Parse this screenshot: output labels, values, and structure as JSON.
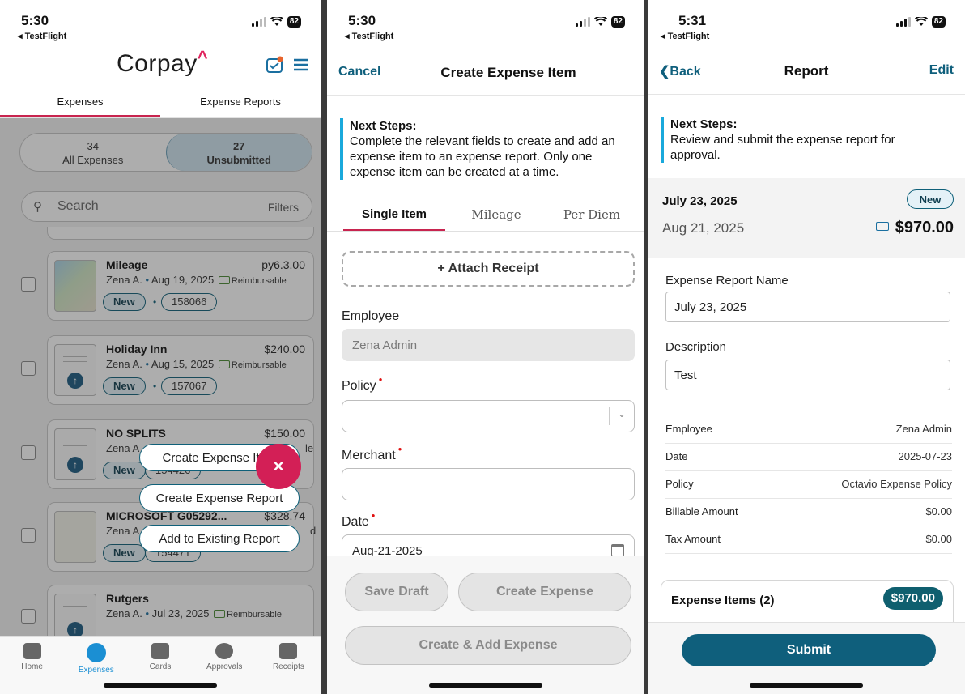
{
  "screen1": {
    "status": {
      "time": "5:30",
      "testflight": "◂ TestFlight",
      "battery": "82"
    },
    "logo": "Corpay",
    "tabs": [
      "Expenses",
      "Expense Reports"
    ],
    "segment": {
      "all_count": "34",
      "all_label": "All Expenses",
      "unsub_count": "27",
      "unsub_label": "Unsubmitted"
    },
    "search": {
      "placeholder": "Search",
      "filters": "Filters"
    },
    "cards": [
      {
        "name": "Mileage",
        "amount": "py6.3.00",
        "meta": "Zena A.",
        "date": "Aug 19, 2025",
        "reimb": "Reimbursable",
        "status": "New",
        "id": "158066"
      },
      {
        "name": "Holiday Inn",
        "amount": "$240.00",
        "meta": "Zena A.",
        "date": "Aug 15, 2025",
        "reimb": "Reimbursable",
        "status": "New",
        "id": "157067"
      },
      {
        "name": "NO SPLITS",
        "amount": "$150.00",
        "meta": "Zena A",
        "date": "",
        "reimb": "le",
        "status": "New",
        "id": "154426"
      },
      {
        "name": "MICROSOFT G05292...",
        "amount": "$328.74",
        "meta": "Zena A",
        "date": "",
        "reimb": "d",
        "status": "New",
        "id": "154471"
      },
      {
        "name": "Rutgers",
        "amount": "",
        "meta": "Zena A.",
        "date": "Jul 23, 2025",
        "reimb": "Reimbursable",
        "status": "",
        "id": ""
      }
    ],
    "menu": [
      "Create Expense Item",
      "Create Expense Report",
      "Add to Existing Report"
    ],
    "fab": "×",
    "tabbar": [
      "Home",
      "Expenses",
      "Cards",
      "Approvals",
      "Receipts"
    ]
  },
  "screen2": {
    "status": {
      "time": "5:30",
      "testflight": "◂ TestFlight",
      "battery": "82"
    },
    "nav": {
      "cancel": "Cancel",
      "title": "Create Expense Item"
    },
    "next_steps": {
      "title": "Next Steps:",
      "body": "Complete the relevant fields to create and add an expense item to an expense report. Only one expense item can be created at a time."
    },
    "tabs": [
      "Single Item",
      "Mileage",
      "Per Diem"
    ],
    "attach": "+ Attach Receipt",
    "fields": {
      "employee_label": "Employee",
      "employee_value": "Zena Admin",
      "policy_label": "Policy",
      "merchant_label": "Merchant",
      "date_label": "Date",
      "date_value": "Aug-21-2025"
    },
    "buttons": {
      "save_draft": "Save Draft",
      "create": "Create Expense",
      "create_add": "Create & Add Expense"
    }
  },
  "screen3": {
    "status": {
      "time": "5:31",
      "testflight": "◂ TestFlight",
      "battery": "82"
    },
    "nav": {
      "back": "Back",
      "title": "Report",
      "edit": "Edit"
    },
    "next_steps": {
      "title": "Next Steps:",
      "body": "Review and submit the expense report for approval."
    },
    "header": {
      "date1": "July 23, 2025",
      "date2": "Aug 21, 2025",
      "badge": "New",
      "amount": "$970.00"
    },
    "report_name_label": "Expense Report Name",
    "report_name_value": "July 23, 2025",
    "description_label": "Description",
    "description_value": "Test",
    "details": [
      {
        "k": "Employee",
        "v": "Zena Admin"
      },
      {
        "k": "Date",
        "v": "2025-07-23"
      },
      {
        "k": "Policy",
        "v": "Octavio Expense Policy"
      },
      {
        "k": "Billable Amount",
        "v": "$0.00"
      },
      {
        "k": "Tax Amount",
        "v": "$0.00"
      }
    ],
    "items": {
      "label": "Expense Items (2)",
      "total": "$970.00"
    },
    "submit": "Submit"
  }
}
